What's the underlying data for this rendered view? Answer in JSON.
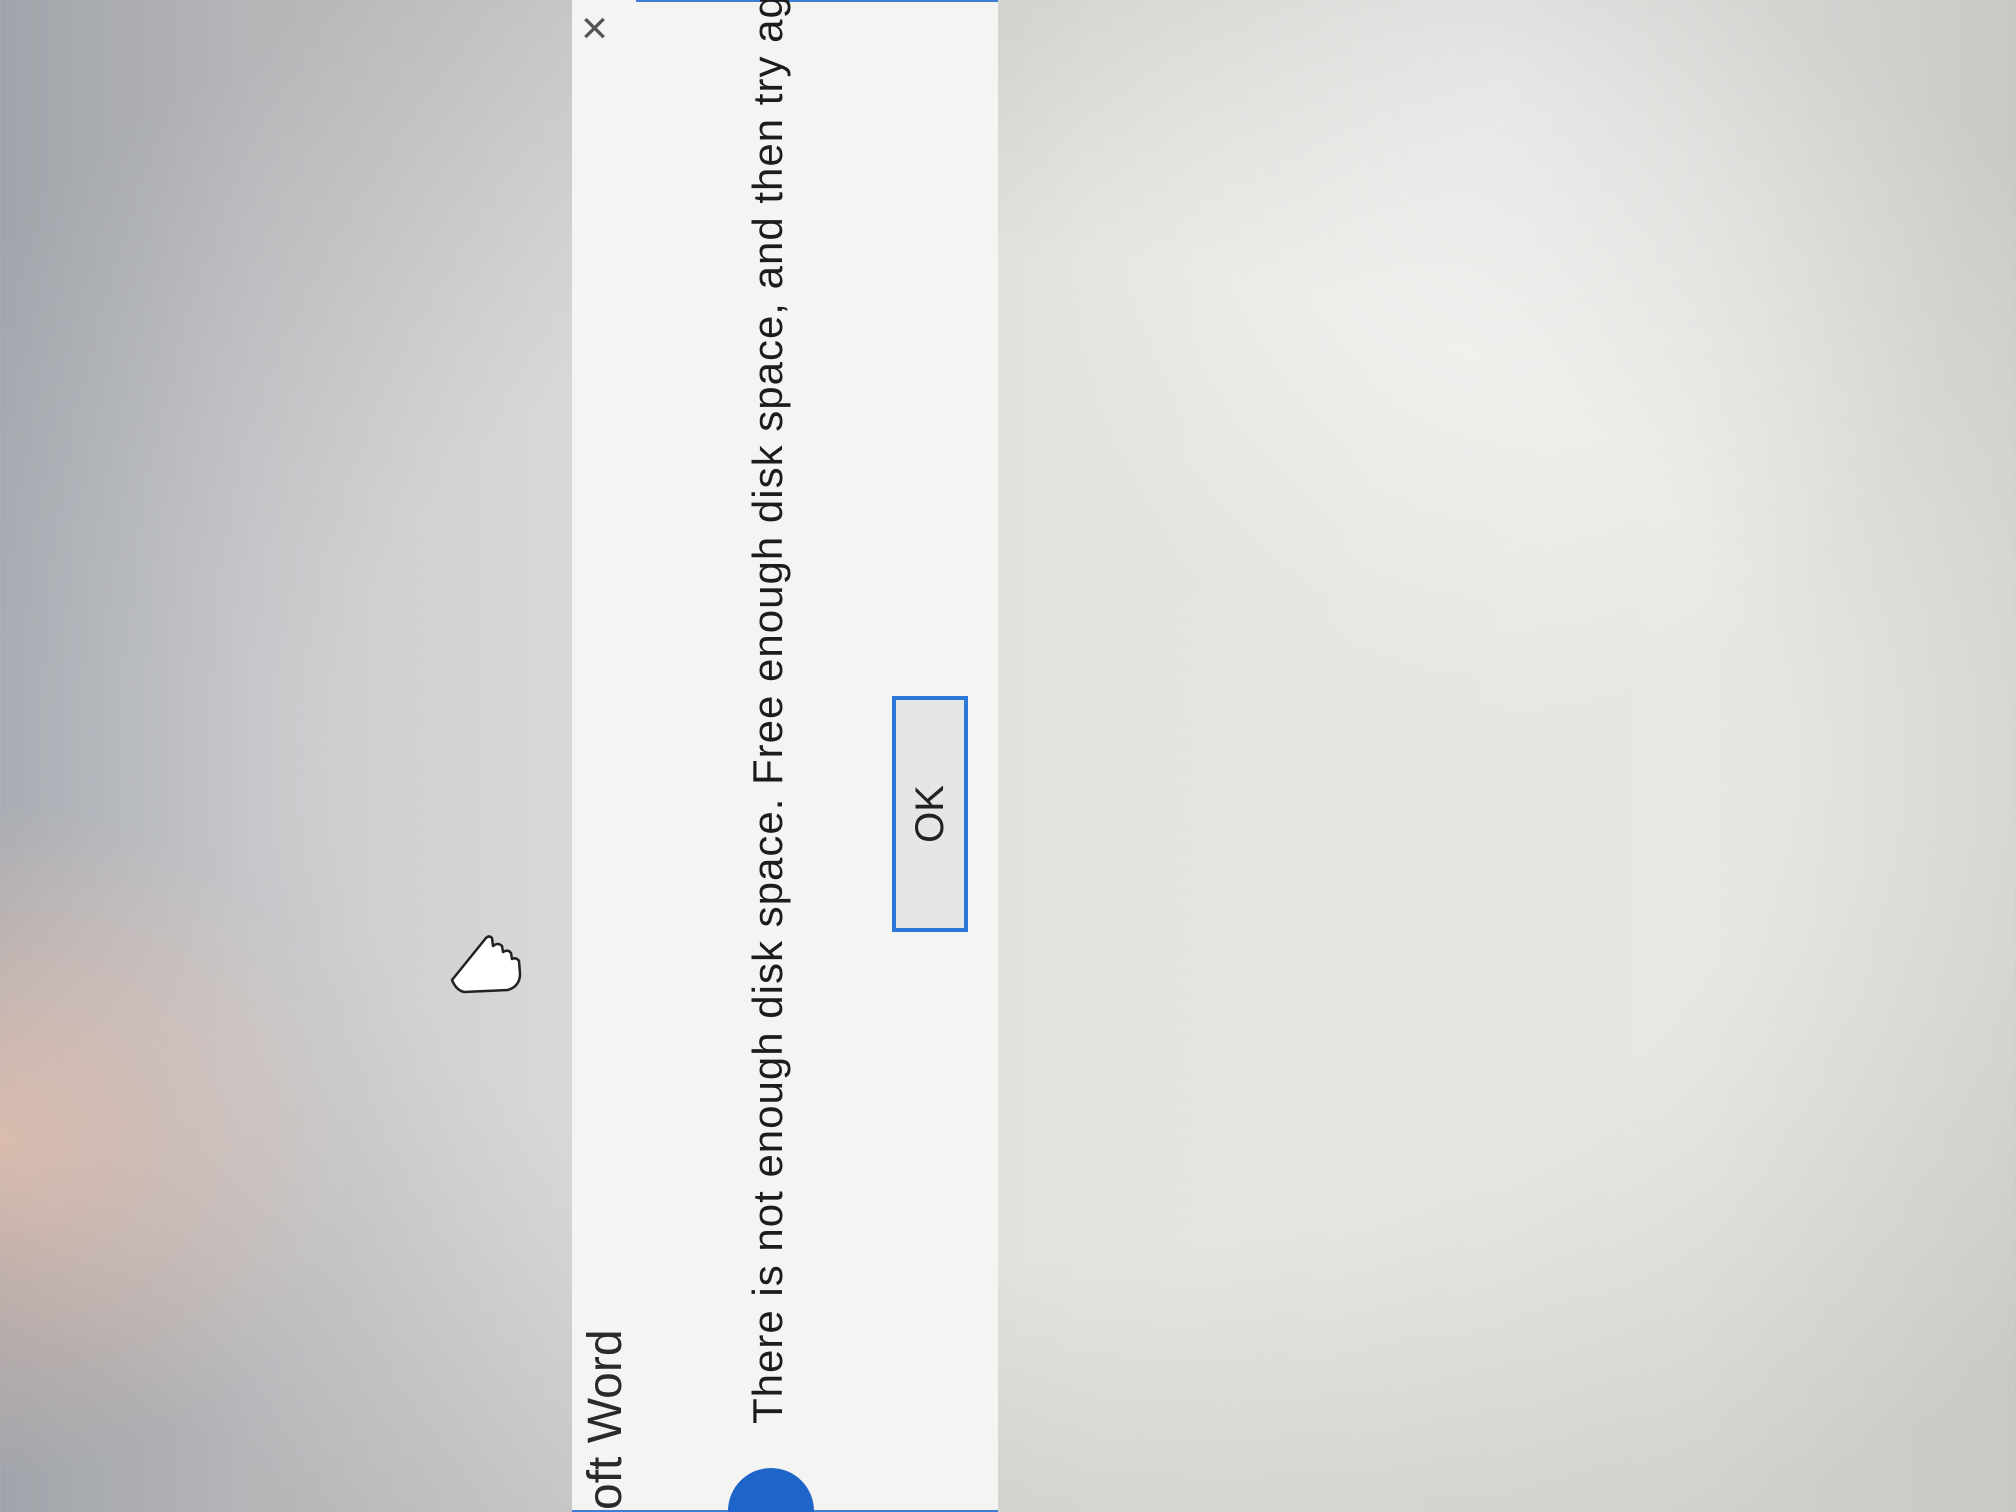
{
  "dialog": {
    "title": "oft Word",
    "close_glyph": "×",
    "message": "There is not enough disk space. Free enough disk space, and then try again",
    "ok_label": "OK",
    "icon": "info-icon",
    "accent_color": "#2b78d8"
  },
  "cursor": {
    "icon": "hand-pointer-icon"
  }
}
